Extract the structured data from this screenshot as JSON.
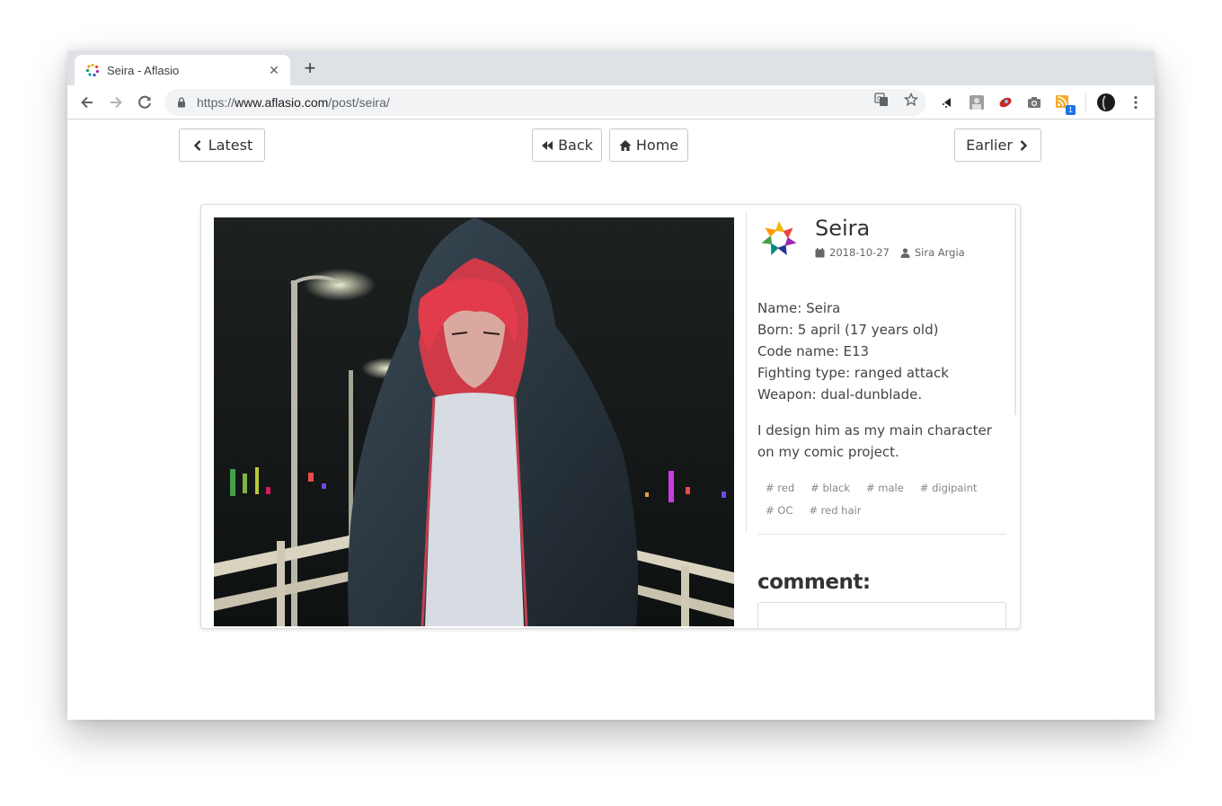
{
  "browser": {
    "tab_title": "Seira - Aflasio",
    "url_prefix": "https://",
    "url_domain": "www.aflasio.com",
    "url_path": "/post/seira/",
    "extension_badge": "1"
  },
  "nav": {
    "latest_label": "Latest",
    "back_label": "Back",
    "home_label": "Home",
    "earlier_label": "Earlier"
  },
  "post": {
    "title": "Seira",
    "date": "2018-10-27",
    "author": "Sira Argia",
    "bio": [
      "Name: Seira",
      "Born: 5 april (17 years old)",
      "Code name: E13",
      "Fighting type: ranged attack",
      "Weapon: dual-dunblade."
    ],
    "description": "I design him as my main character on my comic project.",
    "tags": [
      "# red",
      "# black",
      "# male",
      "# digipaint",
      "# OC",
      "# red hair"
    ]
  },
  "comments": {
    "heading": "comment:"
  }
}
